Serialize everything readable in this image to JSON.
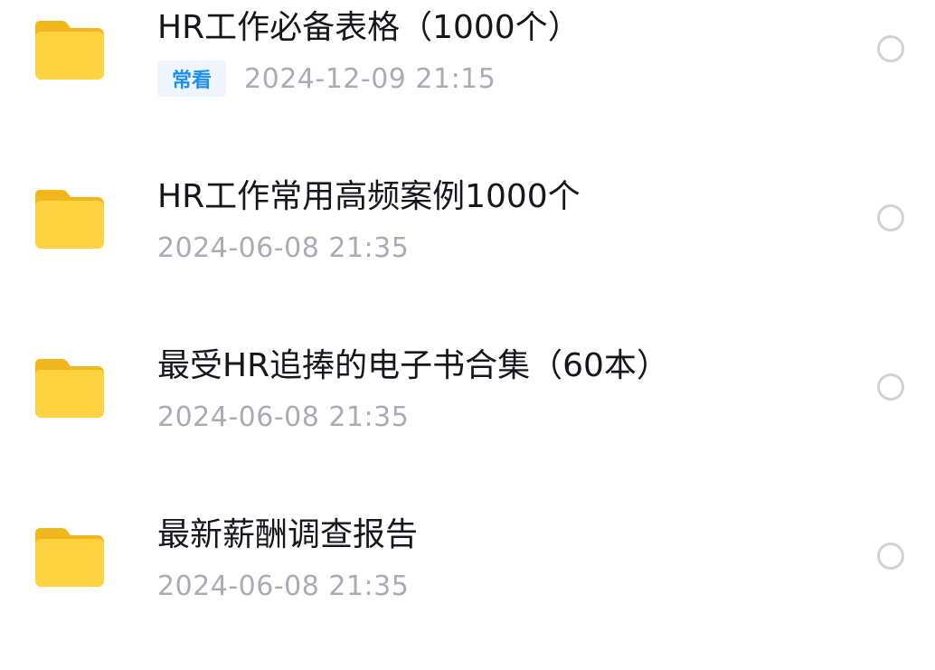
{
  "files": [
    {
      "icon": "folder-icon",
      "name": "HR工作必备表格（1000个）",
      "badge": "常看",
      "date": "2024-12-09 21:15"
    },
    {
      "icon": "folder-icon",
      "name": "HR工作常用高频案例1000个",
      "badge": "",
      "date": "2024-06-08 21:35"
    },
    {
      "icon": "folder-icon",
      "name": "最受HR追捧的电子书合集（60本）",
      "badge": "",
      "date": "2024-06-08 21:35"
    },
    {
      "icon": "folder-icon",
      "name": "最新薪酬调查报告",
      "badge": "",
      "date": "2024-06-08 21:35"
    }
  ],
  "colors": {
    "folder": "#FFD23F",
    "badge_text": "#1F8EF2",
    "date_text": "#A9ACB4"
  }
}
